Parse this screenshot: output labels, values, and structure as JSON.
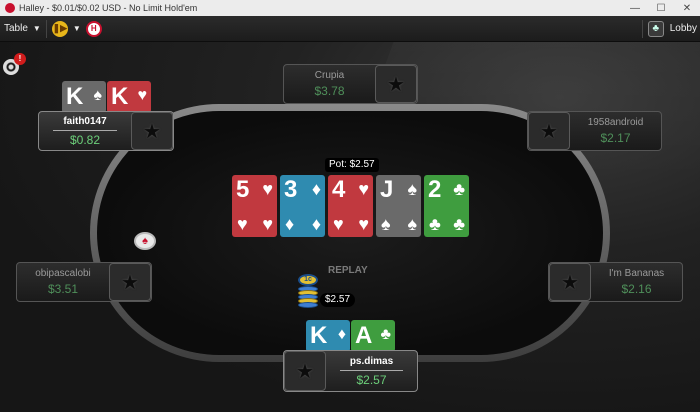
{
  "window": {
    "title": "Halley - $0.01/$0.02 USD - No Limit Hold'em",
    "minimize": "—",
    "maximize": "☐",
    "close": "✕"
  },
  "toolbar": {
    "table_label": "Table",
    "caret": "▼",
    "lobby_label": "Lobby"
  },
  "notification": {
    "count": "!"
  },
  "seats": {
    "top": {
      "name": "Crupia",
      "stack": "$3.78"
    },
    "top_left": {
      "name": "faith0147",
      "stack": "$0.82"
    },
    "top_right": {
      "name": "1958android",
      "stack": "$2.17"
    },
    "left": {
      "name": "obipascalobi",
      "stack": "$3.51"
    },
    "right": {
      "name": "I'm Bananas",
      "stack": "$2.16"
    },
    "hero": {
      "name": "ps.dimas",
      "stack": "$2.57"
    }
  },
  "pot": "Pot: $2.57",
  "replay": "REPLAY",
  "bet": {
    "amount": "$2.57",
    "chip_value": "1c"
  },
  "board": [
    {
      "rank": "5",
      "suit": "♥",
      "color": "#c1393f"
    },
    {
      "rank": "3",
      "suit": "♦",
      "color": "#2f8bb0"
    },
    {
      "rank": "4",
      "suit": "♥",
      "color": "#c1393f"
    },
    {
      "rank": "J",
      "suit": "♠",
      "color": "#6a6a6a"
    },
    {
      "rank": "2",
      "suit": "♣",
      "color": "#3f9d3f"
    }
  ],
  "hands": {
    "top_left": [
      {
        "rank": "K",
        "suit": "♠",
        "color": "#6a6a6a"
      },
      {
        "rank": "K",
        "suit": "♥",
        "color": "#c1393f"
      }
    ],
    "hero": [
      {
        "rank": "K",
        "suit": "♦",
        "color": "#2f8bb0"
      },
      {
        "rank": "A",
        "suit": "♣",
        "color": "#3f9d3f"
      }
    ]
  },
  "icons": {
    "avatar": "★",
    "dealer": "♠",
    "lobby": "♣"
  }
}
